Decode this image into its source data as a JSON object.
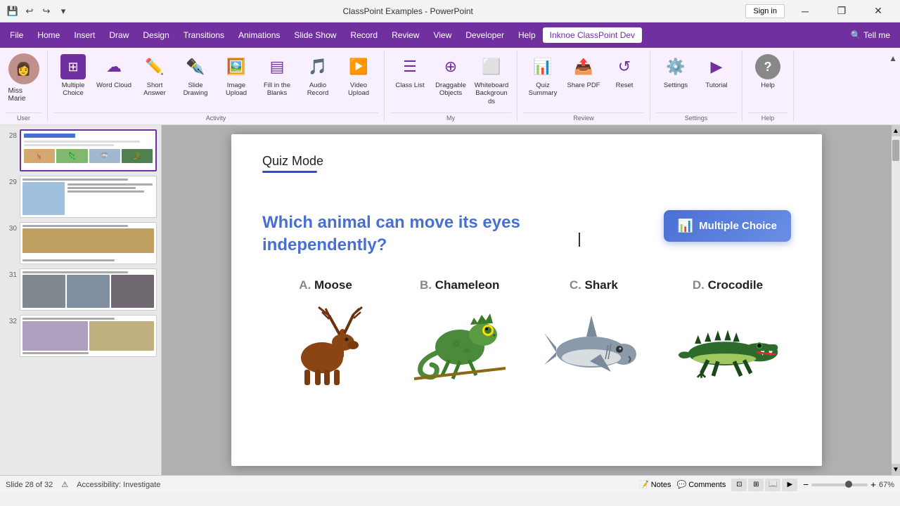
{
  "titlebar": {
    "title": "ClassPoint Examples - PowerPoint",
    "signinLabel": "Sign in"
  },
  "quickaccess": {
    "save": "💾",
    "undo": "↩",
    "redo": "↪",
    "customize": "▼"
  },
  "menubar": {
    "items": [
      "File",
      "Home",
      "Insert",
      "Draw",
      "Design",
      "Transitions",
      "Animations",
      "Slide Show",
      "Record",
      "Review",
      "View",
      "Developer",
      "Help"
    ],
    "activeItem": "Inknoe ClassPoint Dev",
    "tellme": "Tell me"
  },
  "ribbon": {
    "user": {
      "name": "Miss Marie"
    },
    "activity": {
      "label": "Activity",
      "buttons": [
        {
          "icon": "⊞",
          "label": "Multiple Choice"
        },
        {
          "icon": "☁",
          "label": "Word Cloud"
        },
        {
          "icon": "✏",
          "label": "Short Answer"
        },
        {
          "icon": "✒",
          "label": "Slide Drawing"
        },
        {
          "icon": "🖼",
          "label": "Image Upload"
        },
        {
          "icon": "▤",
          "label": "Fill in the Blanks"
        },
        {
          "icon": "🎵",
          "label": "Audio Record"
        },
        {
          "icon": "▶",
          "label": "Video Upload"
        }
      ]
    },
    "my": {
      "label": "My",
      "buttons": [
        {
          "icon": "☰",
          "label": "Class List"
        },
        {
          "icon": "⊕",
          "label": "Draggable Objects"
        },
        {
          "icon": "⬜",
          "label": "Whiteboard Backgrounds"
        }
      ]
    },
    "review": {
      "label": "Review",
      "buttons": [
        {
          "icon": "📊",
          "label": "Quiz Summary"
        },
        {
          "icon": "📤",
          "label": "Share PDF"
        },
        {
          "icon": "↺",
          "label": "Reset"
        }
      ]
    },
    "settings": {
      "label": "Settings",
      "buttons": [
        {
          "icon": "⚙",
          "label": "Settings"
        },
        {
          "icon": "▶",
          "label": "Tutorial"
        }
      ]
    },
    "help": {
      "label": "Help",
      "buttons": [
        {
          "icon": "?",
          "label": "Help"
        }
      ]
    }
  },
  "slides": {
    "current": 28,
    "total": 32,
    "items": [
      {
        "num": "28",
        "active": true
      },
      {
        "num": "29",
        "active": false
      },
      {
        "num": "30",
        "active": false
      },
      {
        "num": "31",
        "active": false
      },
      {
        "num": "32",
        "active": false
      }
    ]
  },
  "slide": {
    "quizModeLabel": "Quiz Mode",
    "question": "Which animal can move its eyes independently?",
    "mcButtonLabel": "Multiple Choice",
    "answers": [
      {
        "letter": "A",
        "name": "Moose",
        "emoji": "🦌"
      },
      {
        "letter": "B",
        "name": "Chameleon",
        "emoji": "🦎"
      },
      {
        "letter": "C",
        "name": "Shark",
        "emoji": "🦈"
      },
      {
        "letter": "D",
        "name": "Crocodile",
        "emoji": "🐊"
      }
    ]
  },
  "statusbar": {
    "slideInfo": "Slide 28 of 32",
    "accessibility": "Accessibility: Investigate",
    "notes": "Notes",
    "comments": "Comments",
    "zoom": "67%"
  }
}
